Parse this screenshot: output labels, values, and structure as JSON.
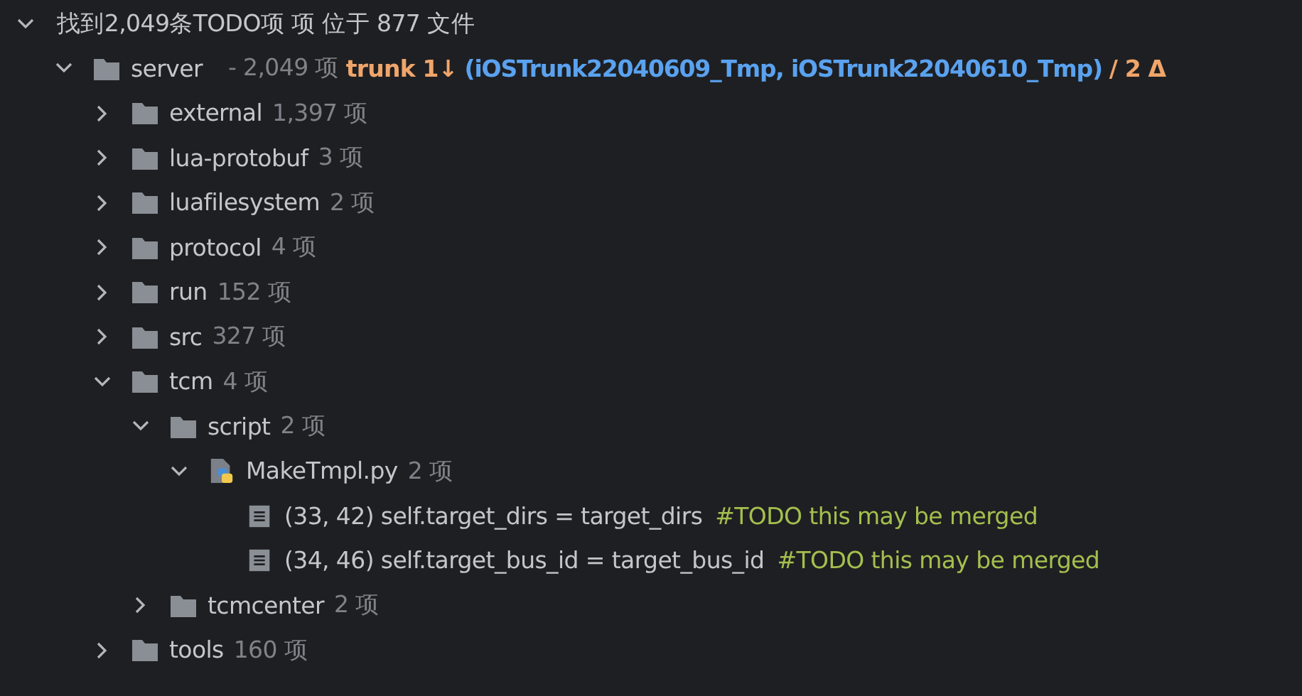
{
  "header": {
    "text": "找到2,049条TODO项 项 位于 877 文件",
    "expanded": true
  },
  "tree": [
    {
      "kind": "folder",
      "name": "server",
      "count": "- 2,049 项",
      "expanded": true,
      "vcs": {
        "branch": "trunk 1↓",
        "refs": "(iOSTrunk22040609_Tmp, iOSTrunk22040610_Tmp)",
        "changes": "/ 2 Δ"
      },
      "children": [
        {
          "kind": "folder",
          "name": "external",
          "count": "1,397 项",
          "expanded": false
        },
        {
          "kind": "folder",
          "name": "lua-protobuf",
          "count": "3 项",
          "expanded": false
        },
        {
          "kind": "folder",
          "name": "luafilesystem",
          "count": "2 项",
          "expanded": false
        },
        {
          "kind": "folder",
          "name": "protocol",
          "count": "4 项",
          "expanded": false
        },
        {
          "kind": "folder",
          "name": "run",
          "count": "152 项",
          "expanded": false
        },
        {
          "kind": "folder",
          "name": "src",
          "count": "327 项",
          "expanded": false
        },
        {
          "kind": "folder",
          "name": "tcm",
          "count": "4 项",
          "expanded": true,
          "children": [
            {
              "kind": "folder",
              "name": "script",
              "count": "2 项",
              "expanded": true,
              "children": [
                {
                  "kind": "python-file",
                  "name": "MakeTmpl.py",
                  "count": "2 项",
                  "expanded": true,
                  "children": [
                    {
                      "kind": "todo",
                      "location": "(33, 42)",
                      "code": "self.target_dirs = target_dirs",
                      "comment": "#TODO this may be merged"
                    },
                    {
                      "kind": "todo",
                      "location": "(34, 46)",
                      "code": "self.target_bus_id = target_bus_id",
                      "comment": "#TODO this may be merged"
                    }
                  ]
                }
              ]
            },
            {
              "kind": "folder",
              "name": "tcmcenter",
              "count": "2 项",
              "expanded": false
            }
          ]
        },
        {
          "kind": "folder",
          "name": "tools",
          "count": "160 项",
          "expanded": false
        }
      ]
    }
  ]
}
